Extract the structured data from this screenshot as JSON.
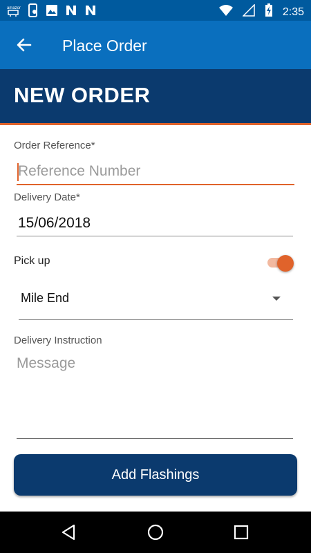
{
  "status_bar": {
    "time": "2:35",
    "left_icons": [
      "amazon-icon",
      "phone-alert-icon",
      "image-icon",
      "n-app-icon",
      "n-app-icon"
    ],
    "right_icons": [
      "wifi-icon",
      "signal-icon",
      "battery-charging-icon"
    ]
  },
  "app_bar": {
    "title": "Place Order",
    "back_icon": "arrow-left-icon"
  },
  "banner": {
    "title": "NEW ORDER"
  },
  "form": {
    "order_reference_label": "Order Reference*",
    "order_reference_placeholder": "Reference Number",
    "order_reference_value": "",
    "delivery_date_label": "Delivery Date*",
    "delivery_date_value": "15/06/2018",
    "pickup_label": "Pick up",
    "pickup_enabled": true,
    "location_value": "Mile End",
    "delivery_instruction_label": "Delivery Instruction",
    "message_placeholder": "Message",
    "message_value": ""
  },
  "actions": {
    "add_flashings_label": "Add Flashings"
  },
  "nav_bar": {
    "icons": [
      "back-triangle-icon",
      "home-circle-icon",
      "recents-square-icon"
    ]
  },
  "colors": {
    "status_bar": "#005a9e",
    "app_bar": "#0a6fbe",
    "banner": "#0b3a6e",
    "accent": "#e0632b",
    "button": "#0b3a6e"
  }
}
